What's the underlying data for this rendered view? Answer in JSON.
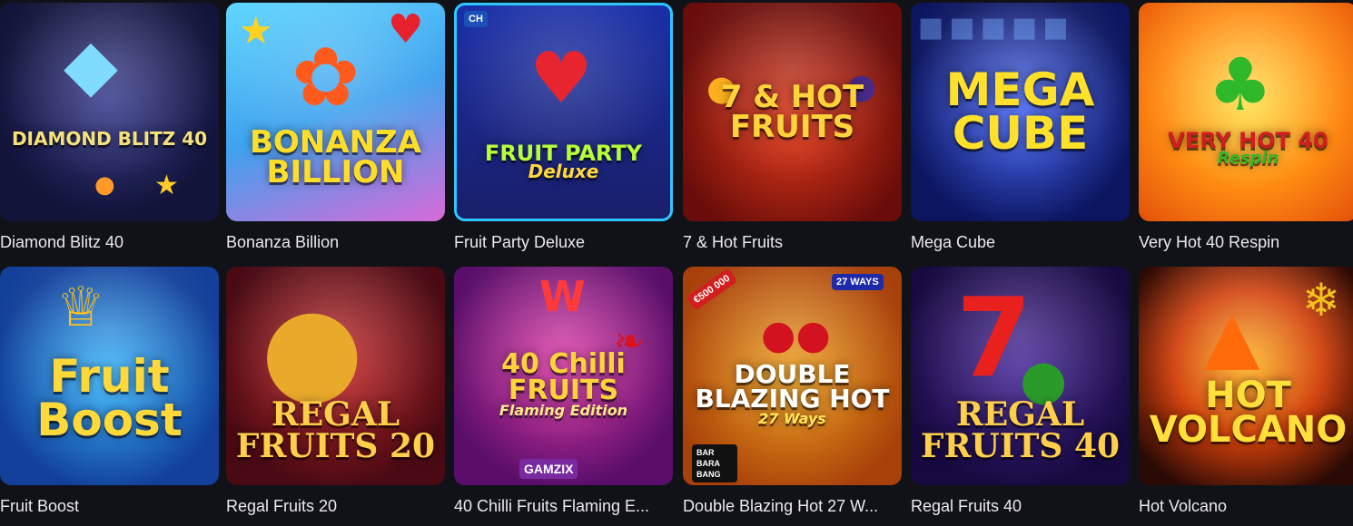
{
  "games": [
    {
      "name": "Diamond Blitz 40",
      "logo": "DIAMOND BLITZ 40",
      "icon": "diamond-icon"
    },
    {
      "name": "Bonanza Billion",
      "logo": "BONANZA BILLION",
      "icon": "flower-icon"
    },
    {
      "name": "Fruit Party Deluxe",
      "logo": "FRUIT PARTY",
      "logo_sub": "Deluxe",
      "icon": "strawberry-icon",
      "provider_badge": "CH"
    },
    {
      "name": "7 & Hot Fruits",
      "logo": "7 & HOT FRUITS",
      "icon": "seven-icon"
    },
    {
      "name": "Mega Cube",
      "logo": "MEGA CUBE",
      "icon": "cube-icon"
    },
    {
      "name": "Very Hot 40 Respin",
      "logo": "VERY HOT 40",
      "logo_sub": "Respin",
      "icon": "clover-icon"
    },
    {
      "name": "Fruit Boost",
      "logo": "Fruit Boost",
      "icon": "crown-icon"
    },
    {
      "name": "Regal Fruits 20",
      "logo": "REGAL FRUITS 20",
      "icon": "coin-icon"
    },
    {
      "name": "40 Chilli Fruits Flaming E...",
      "logo": "40 Chilli FRUITS",
      "logo_sub": "Flaming Edition",
      "icon": "chilli-icon",
      "provider_badge": "GAMZIX"
    },
    {
      "name": "Double Blazing Hot 27 W...",
      "logo": "DOUBLE BLAZING HOT",
      "logo_sub": "27 Ways",
      "icon": "cherry-icon",
      "ribbon": "€500 000",
      "ways_badge": "27 WAYS",
      "provider_badge": "BAR BARA BANG"
    },
    {
      "name": "Regal Fruits 40",
      "logo": "REGAL FRUITS 40",
      "icon": "watermelon-icon"
    },
    {
      "name": "Hot Volcano",
      "logo": "HOT VOLCANO",
      "icon": "volcano-icon"
    }
  ],
  "colors": {
    "background": "#111217",
    "label": "#e9e9ee"
  }
}
